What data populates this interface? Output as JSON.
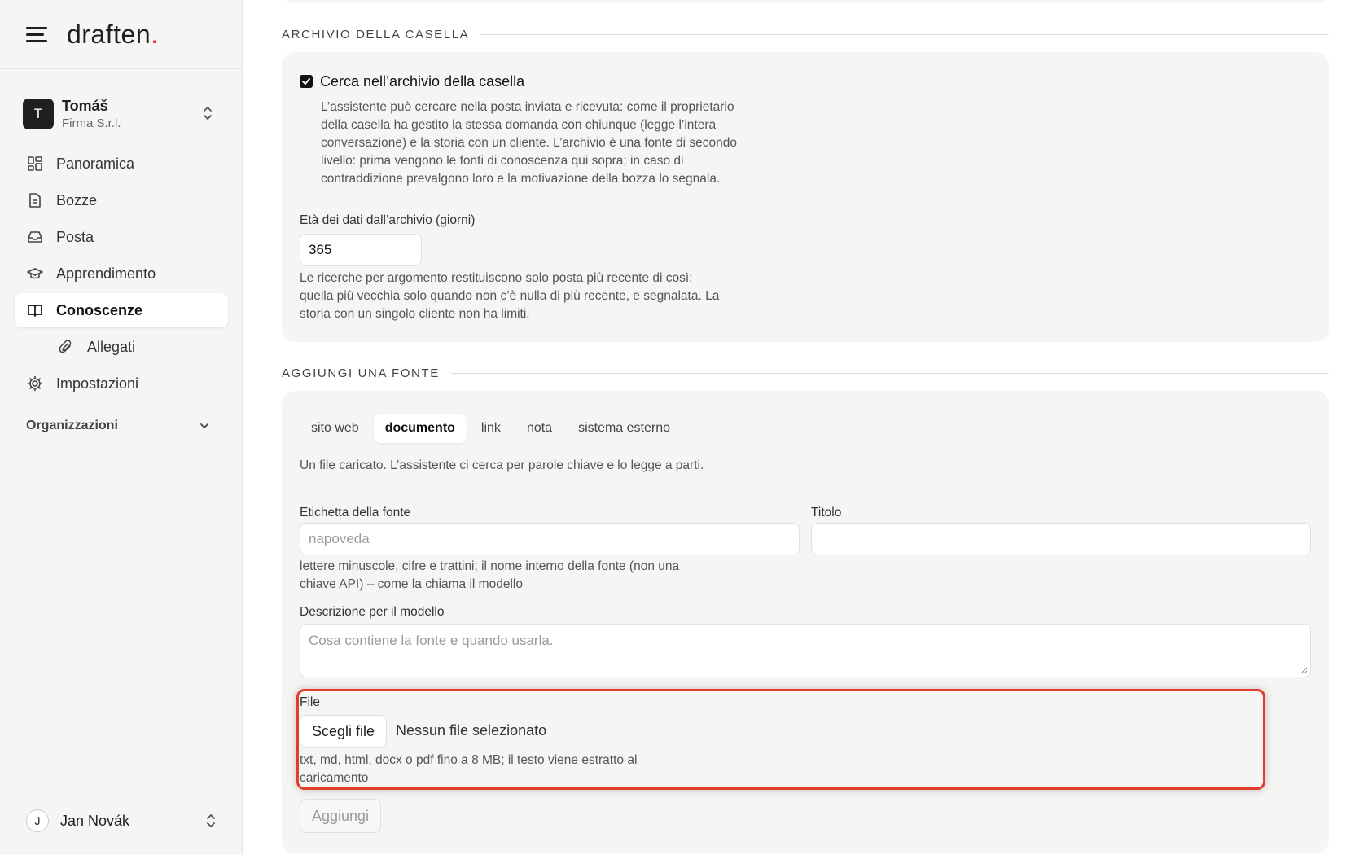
{
  "brand": {
    "logo_text": "draften",
    "logo_dot": "."
  },
  "org": {
    "initial": "T",
    "name": "Tomáš",
    "company": "Firma S.r.l."
  },
  "nav": {
    "items": [
      {
        "label": "Panoramica"
      },
      {
        "label": "Bozze"
      },
      {
        "label": "Posta"
      },
      {
        "label": "Apprendimento"
      },
      {
        "label": "Conoscenze"
      },
      {
        "label": "Allegati"
      },
      {
        "label": "Impostazioni"
      }
    ],
    "group": "Organizzazioni"
  },
  "user": {
    "initial": "J",
    "name": "Jan Novák"
  },
  "archive": {
    "section_title": "ARCHIVIO DELLA CASELLA",
    "checkbox_label": "Cerca nell’archivio della casella",
    "checkbox_checked": true,
    "checkbox_desc": "L’assistente può cercare nella posta inviata e ricevuta: come il proprietario della casella ha gestito la stessa domanda con chiunque (legge l’intera conversazione) e la storia con un cliente. L’archivio è una fonte di secondo livello: prima vengono le fonti di conoscenza qui sopra; in caso di contraddizione prevalgono loro e la motivazione della bozza lo segnala.",
    "age_label": "Età dei dati dall’archivio (giorni)",
    "age_value": "365",
    "age_help": "Le ricerche per argomento restituiscono solo posta più recente di così; quella più vecchia solo quando non c’è nulla di più recente, e segnalata. La storia con un singolo cliente non ha limiti."
  },
  "add_source": {
    "section_title": "AGGIUNGI UNA FONTE",
    "tabs": [
      "sito web",
      "documento",
      "link",
      "nota",
      "sistema esterno"
    ],
    "active_tab": "documento",
    "tab_desc": "Un file caricato. L’assistente ci cerca per parole chiave e lo legge a parti.",
    "label_field": {
      "label": "Etichetta della fonte",
      "placeholder": "napoveda",
      "value": ""
    },
    "label_help": "lettere minuscole, cifre e trattini; il nome interno della fonte (non una chiave API) – come la chiama il modello",
    "title_field": {
      "label": "Titolo",
      "value": ""
    },
    "desc_field": {
      "label": "Descrizione per il modello",
      "placeholder": "Cosa contiene la fonte e quando usarla."
    },
    "file": {
      "label": "File",
      "button": "Scegli file",
      "status": "Nessun file selezionato",
      "help": "txt, md, html, docx o pdf fino a 8 MB; il testo viene estratto al caricamento"
    },
    "submit": "Aggiungi"
  },
  "colors": {
    "accent": "#e03d2c",
    "panel": "#f5f5f4"
  }
}
